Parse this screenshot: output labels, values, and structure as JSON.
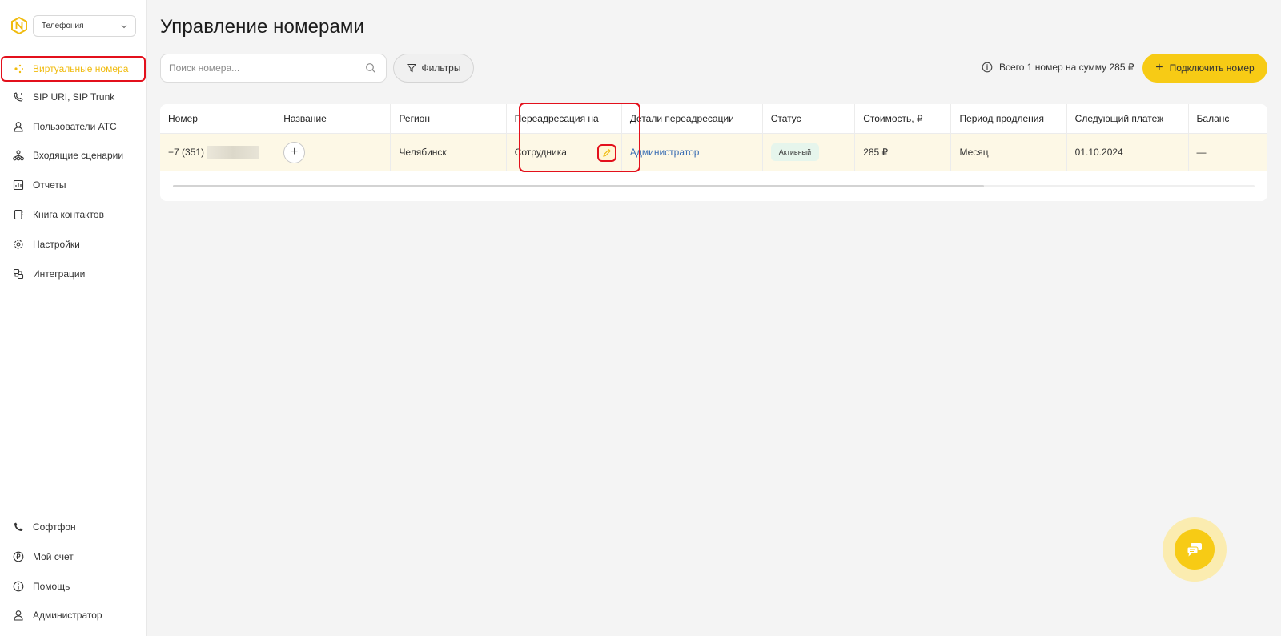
{
  "app": {
    "product_select": "Телефония"
  },
  "sidebar": {
    "items": [
      {
        "label": "Виртуальные номера",
        "icon": "virtual-numbers-icon",
        "active": true
      },
      {
        "label": "SIP URI, SIP Trunk",
        "icon": "sip-phone-icon"
      },
      {
        "label": "Пользователи АТС",
        "icon": "user-icon"
      },
      {
        "label": "Входящие сценарии",
        "icon": "scenario-tree-icon"
      },
      {
        "label": "Отчеты",
        "icon": "reports-icon"
      },
      {
        "label": "Книга контактов",
        "icon": "contact-book-icon"
      },
      {
        "label": "Настройки",
        "icon": "gear-icon"
      },
      {
        "label": "Интеграции",
        "icon": "integrations-icon"
      }
    ],
    "bottom_items": [
      {
        "label": "Софтфон",
        "icon": "phone-icon"
      },
      {
        "label": "Мой счет",
        "icon": "ruble-circle-icon"
      },
      {
        "label": "Помощь",
        "icon": "info-circle-icon"
      },
      {
        "label": "Администратор",
        "icon": "user-icon"
      }
    ]
  },
  "main": {
    "title": "Управление номерами",
    "search_placeholder": "Поиск номера...",
    "filters_label": "Фильтры",
    "total_info": "Всего 1 номер на сумму 285 ₽",
    "connect_label": "Подключить номер"
  },
  "table": {
    "columns": [
      "Номер",
      "Название",
      "Регион",
      "Переадресация на",
      "Детали переадресации",
      "Статус",
      "Стоимость, ₽",
      "Период продления",
      "Следующий платеж",
      "Баланс"
    ],
    "rows": [
      {
        "number": "+7 (351)",
        "region": "Челябинск",
        "forward_to": "Сотрудника",
        "forward_details": "Администратор",
        "status": "Активный",
        "cost": "285 ₽",
        "period": "Месяц",
        "next_payment": "01.10.2024",
        "balance": "—"
      }
    ],
    "scroll_fraction": 0.75
  },
  "colors": {
    "accent": "#f7cb15",
    "active_nav": "#f0bb0e",
    "highlight_border": "#e3101c",
    "link": "#3c6fb4",
    "row_bg": "#fdf8e6"
  }
}
